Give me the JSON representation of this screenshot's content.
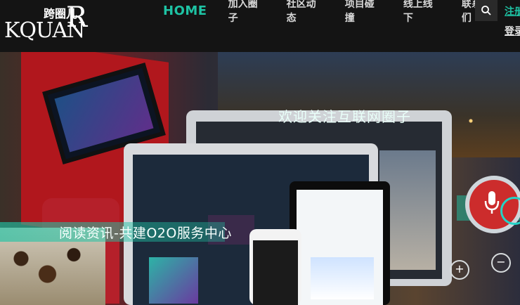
{
  "header": {
    "logo": {
      "brand_text": "KQUAN",
      "cn_text": "跨圈儿",
      "reg_mark": "R"
    },
    "nav": [
      {
        "label": "HOME",
        "active": true
      },
      {
        "label": "加入圈子"
      },
      {
        "label": "社区动态"
      },
      {
        "label": "项目碰撞"
      },
      {
        "label": "线上线下"
      },
      {
        "label": "联系我们"
      }
    ],
    "register_label": "注册",
    "login_label": "登录",
    "accent_color": "#1ec3a4"
  },
  "hero": {
    "caption_top": "欢迎关注互联网圈子",
    "caption_main": "阅读资讯-共建O2O服务中心"
  }
}
